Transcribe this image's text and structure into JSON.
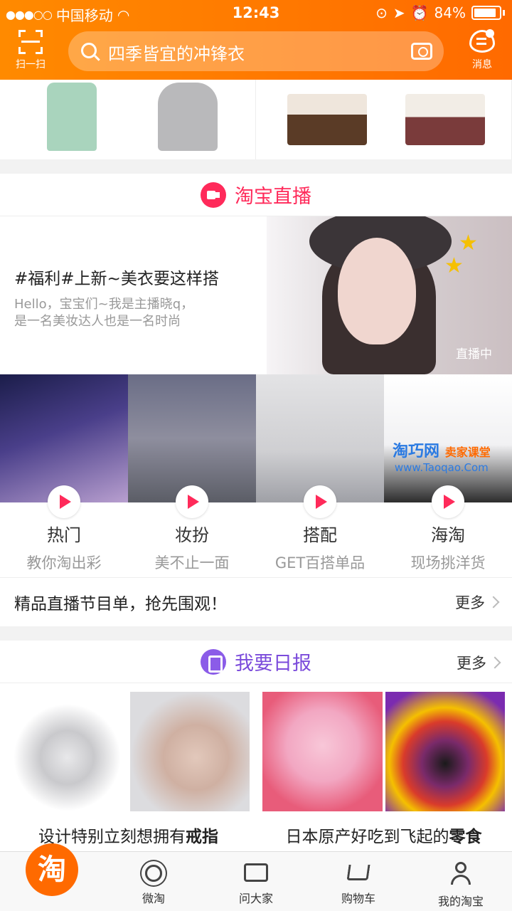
{
  "status": {
    "carrier": "中国移动",
    "time": "12:43",
    "battery": "84%"
  },
  "header": {
    "scan_label": "扫一扫",
    "search_placeholder": "四季皆宜的冲锋衣",
    "messages_label": "消息"
  },
  "live": {
    "section_title": "淘宝直播",
    "feature": {
      "title": "#福利#上新~美衣要这样搭",
      "desc_line1": "Hello，宝宝们~我是主播晓q，",
      "desc_line2": "是一名美妆达人也是一名时尚",
      "tag": "直播中"
    },
    "categories": [
      {
        "name": "热门",
        "sub": "教你淘出彩"
      },
      {
        "name": "妆扮",
        "sub": "美不止一面"
      },
      {
        "name": "搭配",
        "sub": "GET百搭单品"
      },
      {
        "name": "海淘",
        "sub": "现场挑洋货"
      }
    ],
    "watermark": {
      "brand": "淘巧网",
      "tag": "卖家课堂",
      "url": "www.Taoqao.Com"
    },
    "program_text": "精品直播节目单，抢先围观！",
    "more_label": "更多"
  },
  "daily": {
    "section_title": "我要日报",
    "more_label": "更多",
    "cards": [
      {
        "title_prefix": "设计特别立刻想拥有",
        "title_bold": "戒指"
      },
      {
        "title_prefix": "日本原产好吃到飞起的",
        "title_bold": "零食"
      }
    ]
  },
  "tabbar": {
    "home_glyph": "淘",
    "items": [
      "微淘",
      "问大家",
      "购物车",
      "我的淘宝"
    ]
  },
  "colors": {
    "header_orange": "#ff7a00",
    "live_pink": "#ff2a5a",
    "daily_purple": "#7b4bdb"
  }
}
